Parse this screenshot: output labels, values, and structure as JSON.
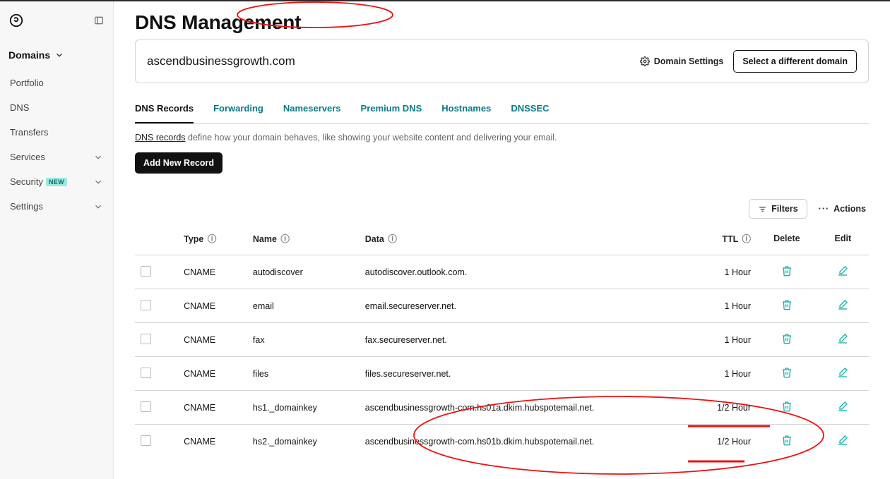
{
  "sidebar": {
    "domains_label": "Domains",
    "items": [
      "Portfolio",
      "DNS",
      "Transfers",
      "Services",
      "Security",
      "Settings"
    ],
    "items_has_chevron": [
      false,
      false,
      false,
      true,
      true,
      true
    ],
    "items_badge": [
      null,
      null,
      null,
      null,
      "NEW",
      null
    ]
  },
  "page": {
    "title": "DNS Management"
  },
  "domain_bar": {
    "domain": "ascendbusinessgrowth.com",
    "settings_label": "Domain Settings",
    "select_label": "Select a different domain"
  },
  "tabs": [
    {
      "label": "DNS Records",
      "active": true
    },
    {
      "label": "Forwarding",
      "active": false
    },
    {
      "label": "Nameservers",
      "active": false
    },
    {
      "label": "Premium DNS",
      "active": false
    },
    {
      "label": "Hostnames",
      "active": false
    },
    {
      "label": "DNSSEC",
      "active": false
    }
  ],
  "description": {
    "link_text": "DNS records",
    "rest": " define how your domain behaves, like showing your website content and delivering your email."
  },
  "buttons": {
    "add_record": "Add New Record",
    "filters": "Filters",
    "actions": "Actions"
  },
  "table": {
    "headers": {
      "type": "Type",
      "name": "Name",
      "data": "Data",
      "ttl": "TTL",
      "delete": "Delete",
      "edit": "Edit"
    },
    "rows": [
      {
        "type": "CNAME",
        "name": "autodiscover",
        "data": "autodiscover.outlook.com.",
        "ttl": "1 Hour"
      },
      {
        "type": "CNAME",
        "name": "email",
        "data": "email.secureserver.net.",
        "ttl": "1 Hour"
      },
      {
        "type": "CNAME",
        "name": "fax",
        "data": "fax.secureserver.net.",
        "ttl": "1 Hour"
      },
      {
        "type": "CNAME",
        "name": "files",
        "data": "files.secureserver.net.",
        "ttl": "1 Hour"
      },
      {
        "type": "CNAME",
        "name": "hs1._domainkey",
        "data": "ascendbusinessgrowth-com.hs01a.dkim.hubspotemail.net.",
        "ttl": "1/2 Hour"
      },
      {
        "type": "CNAME",
        "name": "hs2._domainkey",
        "data": "ascendbusinessgrowth-com.hs01b.dkim.hubspotemail.net.",
        "ttl": "1/2 Hour"
      }
    ]
  }
}
